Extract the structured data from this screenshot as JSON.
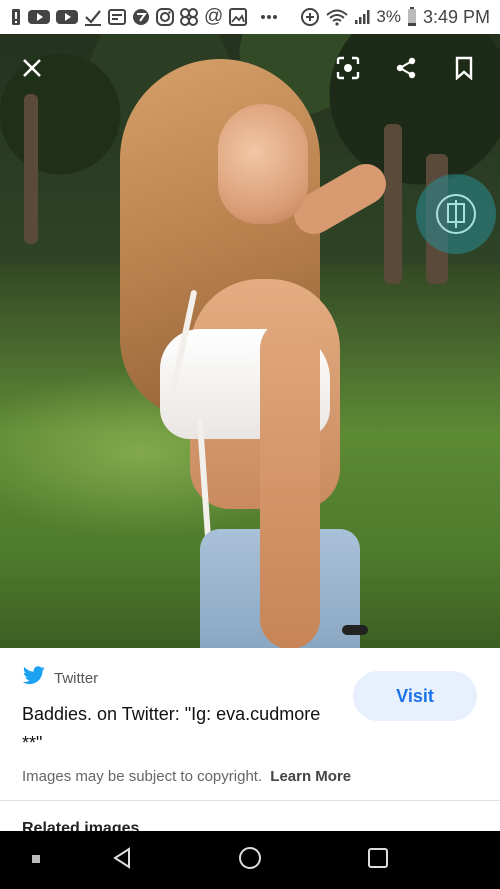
{
  "status_bar": {
    "left_icons": [
      "alert-icon",
      "youtube-icon",
      "youtube-icon",
      "check-icon",
      "news-icon",
      "app-icon",
      "instagram-icon",
      "pinwheel-icon",
      "at-icon",
      "gallery-icon",
      "more-dots-icon"
    ],
    "battery": "3%",
    "time": "3:49 PM"
  },
  "viewer": {
    "close_icon": "close-icon",
    "lens_icon": "lens-icon",
    "share_icon": "share-icon",
    "bookmark_icon": "bookmark-icon"
  },
  "result": {
    "source": "Twitter",
    "title": "Baddies. on Twitter: \"Ig: eva.cudmore **\"",
    "visit_label": "Visit",
    "copyright": "Images may be subject to copyright.",
    "learn_more": "Learn More",
    "related": "Related images"
  },
  "colors": {
    "accent": "#1a73e8",
    "visit_bg": "#e8f0fe",
    "twitter_blue": "#1da1f2"
  }
}
